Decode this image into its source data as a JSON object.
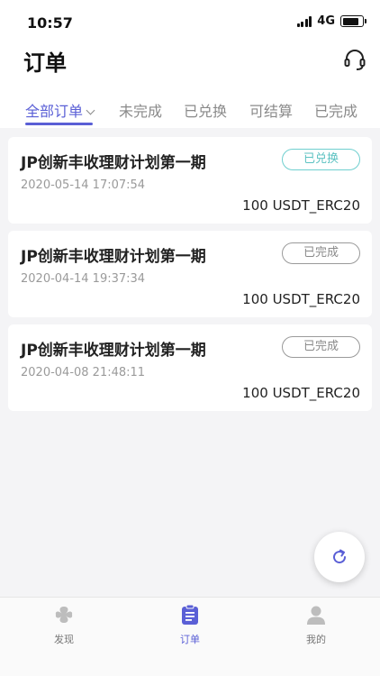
{
  "status_bar": {
    "time": "10:57",
    "network": "4G",
    "battery_level": 0.85
  },
  "header": {
    "title": "订单",
    "support_icon": "headset-icon"
  },
  "tabs": [
    {
      "label": "全部订单",
      "active": true
    },
    {
      "label": "未完成",
      "active": false
    },
    {
      "label": "已兑换",
      "active": false
    },
    {
      "label": "可结算",
      "active": false
    },
    {
      "label": "已完成",
      "active": false
    }
  ],
  "orders": [
    {
      "title": "JP创新丰收理财计划第一期",
      "date": "2020-05-14 17:07:54",
      "amount": "100 USDT_ERC20",
      "status": "已兑换"
    },
    {
      "title": "JP创新丰收理财计划第一期",
      "date": "2020-04-14 19:37:34",
      "amount": "100 USDT_ERC20",
      "status": "已完成"
    },
    {
      "title": "JP创新丰收理财计划第一期",
      "date": "2020-04-08 21:48:11",
      "amount": "100 USDT_ERC20",
      "status": "已完成"
    }
  ],
  "colors": {
    "accent": "#5a5fd6",
    "teal": "#5cc2c2",
    "muted": "#8a8a8a"
  },
  "bottom_nav": [
    {
      "label": "发现",
      "icon": "discover-icon",
      "active": false
    },
    {
      "label": "订单",
      "icon": "orders-icon",
      "active": true
    },
    {
      "label": "我的",
      "icon": "profile-icon",
      "active": false
    }
  ]
}
